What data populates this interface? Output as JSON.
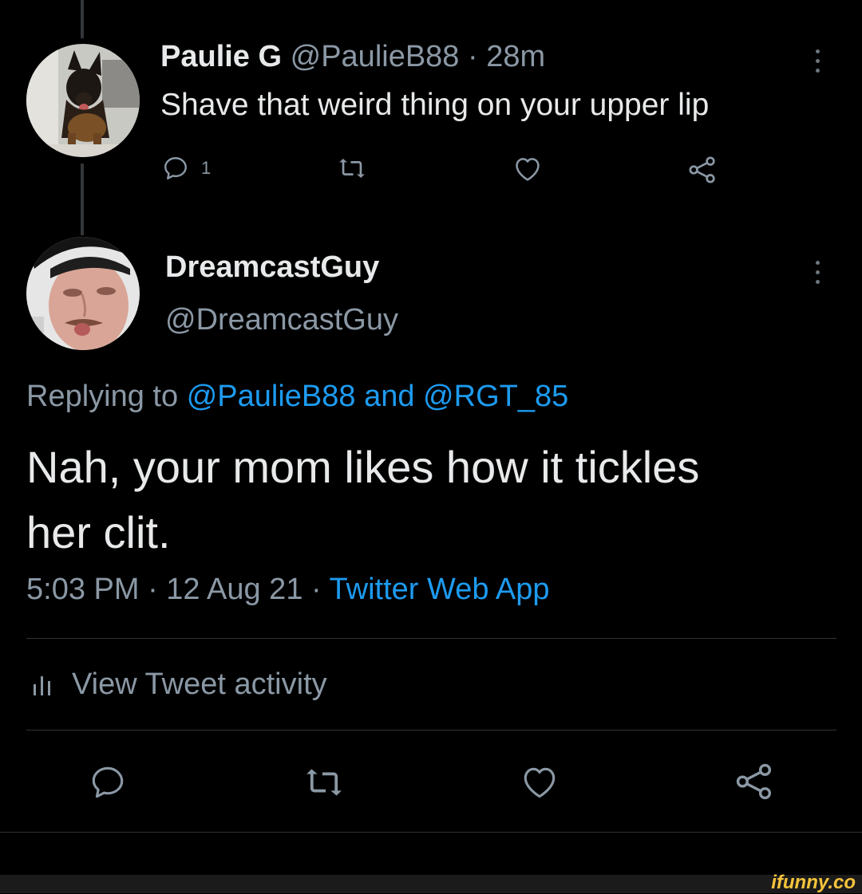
{
  "parent_tweet": {
    "display_name": "Paulie G",
    "handle_time": "@PaulieB88 · 28m",
    "text": "Shave that weird thing on your upper lip",
    "reply_count": "1",
    "avatar_icon": "dog-avatar"
  },
  "main_tweet": {
    "display_name": "DreamcastGuy",
    "handle": "@DreamcastGuy",
    "avatar_icon": "person-avatar",
    "replying_prefix": "Replying to",
    "replying_user1": "@PaulieB88",
    "replying_and": "and",
    "replying_user2": "@RGT_85",
    "text_line1": "Nah, your mom likes how it tickles",
    "text_line2": "her clit.",
    "timestamp": "5:03 PM · 12 Aug 21 ·",
    "source": "Twitter Web App",
    "activity_label": "View Tweet activity"
  },
  "watermark": "ifunny.co",
  "colors": {
    "background": "#000000",
    "text": "#e7e9ea",
    "muted": "#8b98a5",
    "link": "#1d9bf0",
    "divider": "#2f3336"
  }
}
